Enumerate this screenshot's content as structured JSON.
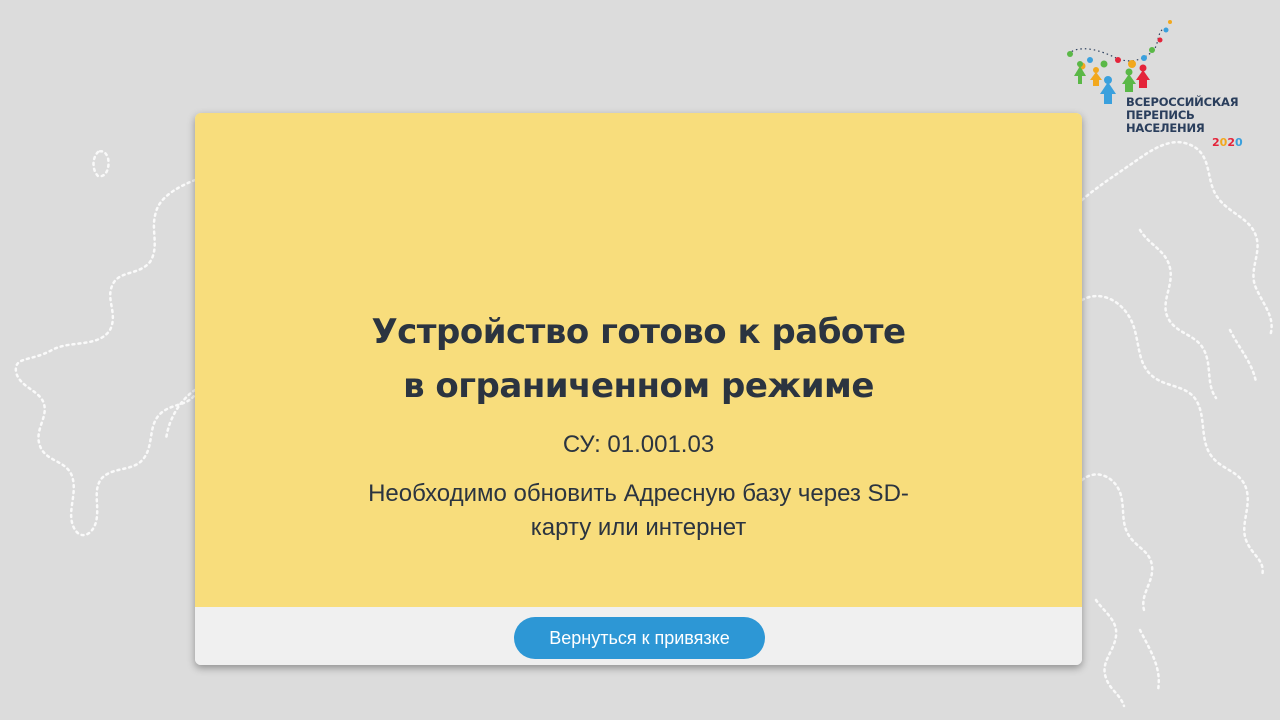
{
  "logo": {
    "line1": "ВСЕРОССИЙСКАЯ",
    "line2": "ПЕРЕПИСЬ",
    "line3": "НАСЕЛЕНИЯ",
    "year": [
      "2",
      "0",
      "2",
      "0"
    ]
  },
  "dialog": {
    "title_line1": "Устройство готово к работе",
    "title_line2": "в ограниченном режиме",
    "su": "СУ: 01.001.03",
    "message_line1": "Необходимо обновить Адресную базу через SD-",
    "message_line2": "карту или интернет",
    "button_label": "Вернуться к привязке"
  },
  "colors": {
    "background": "#dcdcdc",
    "dialog_body": "#f8dd7c",
    "dialog_footer": "#f0f0f0",
    "button": "#2d97d5",
    "text": "#2b3440"
  },
  "icons": [
    "russia-map-outline",
    "census-logo-figures"
  ]
}
